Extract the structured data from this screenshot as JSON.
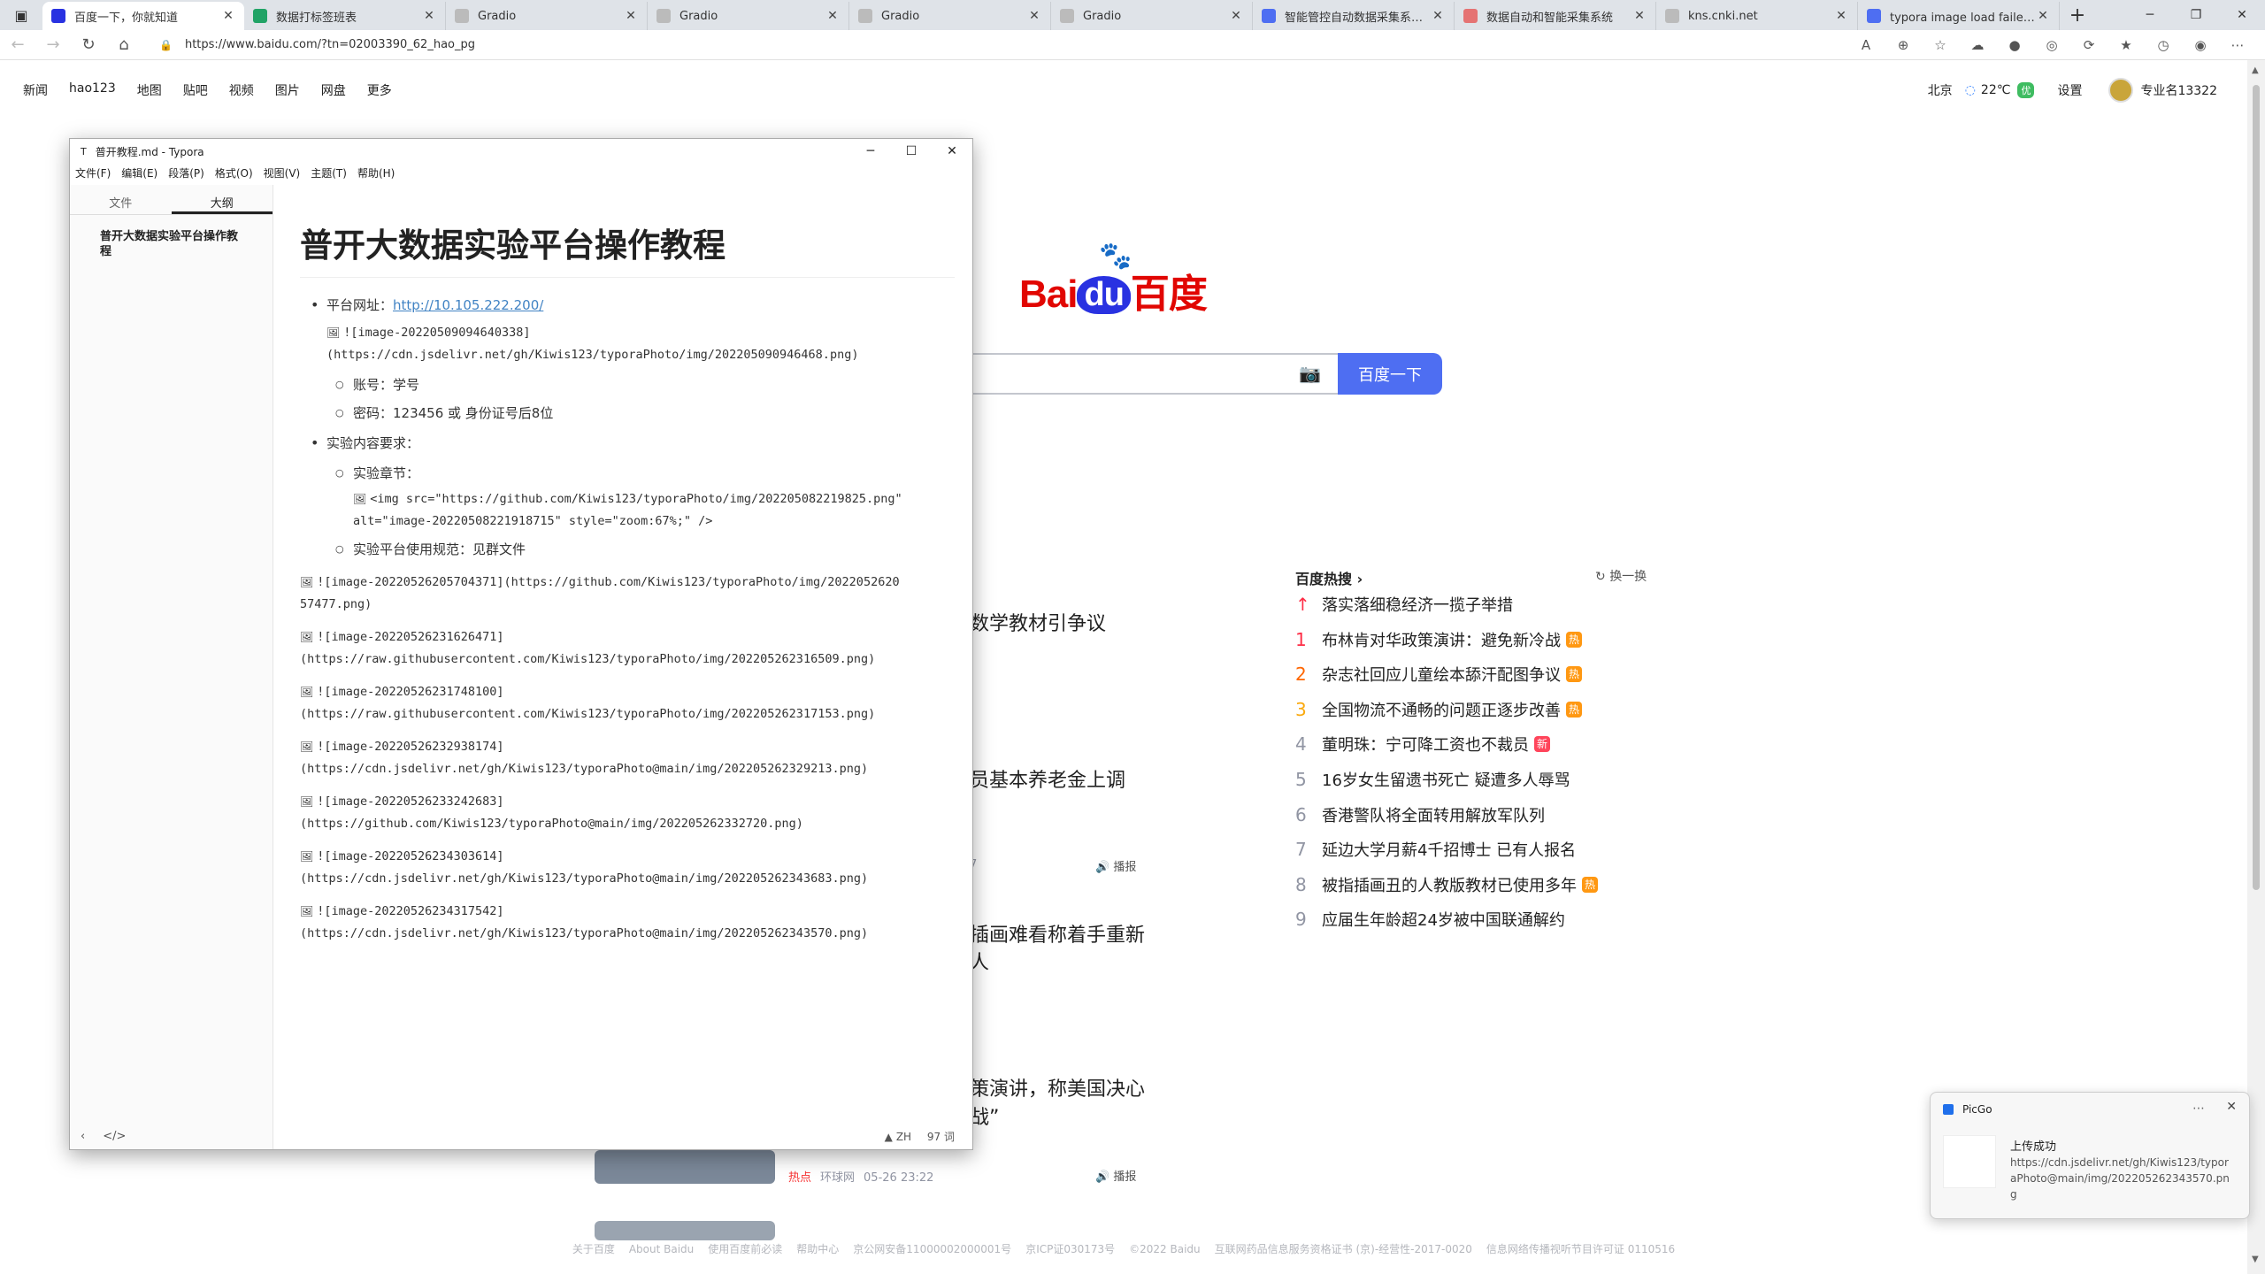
{
  "browser": {
    "tabs": [
      {
        "label": "百度一下，你就知道",
        "icon": "baidu-paw-icon",
        "color": "#2932e1",
        "active": true
      },
      {
        "label": "数据打标签班表",
        "icon": "sheet-icon",
        "color": "#21a366"
      },
      {
        "label": "Gradio",
        "icon": "page-icon",
        "color": "#bbb"
      },
      {
        "label": "Gradio",
        "icon": "page-icon",
        "color": "#bbb"
      },
      {
        "label": "Gradio",
        "icon": "page-icon",
        "color": "#bbb"
      },
      {
        "label": "Gradio",
        "icon": "page-icon",
        "color": "#bbb"
      },
      {
        "label": "智能管控自动数据采集系统和",
        "icon": "search-icon",
        "color": "#4e6ef2"
      },
      {
        "label": "数据自动和智能采集系统",
        "icon": "doc-icon",
        "color": "#e57373"
      },
      {
        "label": "kns.cnki.net",
        "icon": "page-icon",
        "color": "#bbb"
      },
      {
        "label": "typora image load failed - 搜索",
        "icon": "search-icon",
        "color": "#4e6ef2"
      }
    ],
    "url": "https://www.baidu.com/?tn=02003390_62_hao_pg"
  },
  "baidu": {
    "nav": [
      "新闻",
      "hao123",
      "地图",
      "贴吧",
      "视频",
      "图片",
      "网盘",
      "更多"
    ],
    "city": "北京",
    "temp": "22℃",
    "aqi": "优",
    "settings": "设置",
    "username": "专业名13322",
    "logo_text": {
      "bai": "Bai",
      "du": "du",
      "cn": "百度"
    },
    "search_button": "百度一下",
    "news": [
      {
        "title": "数学教材引争议"
      },
      {
        "title": "员基本养老金上调",
        "meta_time": "7",
        "report": "播报"
      },
      {
        "title_line1": "插画难看称着手重新",
        "title_line2": "人"
      },
      {
        "title_line1": "策演讲，称美国决心",
        "title_line2": "战”",
        "hot": "热点",
        "source": "环球网",
        "time": "05-26 23:22",
        "report": "播报"
      }
    ],
    "hot": {
      "title": "百度热搜",
      "refresh": "换一换",
      "items": [
        {
          "rank": "↑",
          "text": "落实落细稳经济一揽子举措",
          "badge": ""
        },
        {
          "rank": "1",
          "text": "布林肯对华政策演讲：避免新冷战",
          "badge": "热"
        },
        {
          "rank": "2",
          "text": "杂志社回应儿童绘本舔汗配图争议",
          "badge": "热"
        },
        {
          "rank": "3",
          "text": "全国物流不通畅的问题正逐步改善",
          "badge": "热"
        },
        {
          "rank": "4",
          "text": "董明珠：宁可降工资也不裁员",
          "badge": "新"
        },
        {
          "rank": "5",
          "text": "16岁女生留遗书死亡 疑遭多人辱骂",
          "badge": ""
        },
        {
          "rank": "6",
          "text": "香港警队将全面转用解放军队列",
          "badge": ""
        },
        {
          "rank": "7",
          "text": "延边大学月薪4千招博士 已有人报名",
          "badge": ""
        },
        {
          "rank": "8",
          "text": "被指插画丑的人教版教材已使用多年",
          "badge": "热"
        },
        {
          "rank": "9",
          "text": "应届生年龄超24岁被中国联通解约",
          "badge": ""
        }
      ]
    },
    "footer": [
      "关于百度",
      "About Baidu",
      "使用百度前必读",
      "帮助中心",
      "京公网安备11000002000001号",
      "京ICP证030173号",
      "©2022 Baidu",
      "互联网药品信息服务资格证书 (京)-经营性-2017-0020",
      "信息网络传播视听节目许可证 0110516"
    ]
  },
  "typora": {
    "title": "普开教程.md - Typora",
    "menu": [
      "文件(F)",
      "编辑(E)",
      "段落(P)",
      "格式(O)",
      "视图(V)",
      "主题(T)",
      "帮助(H)"
    ],
    "side_tabs": {
      "files": "文件",
      "outline": "大纲"
    },
    "outline_item": "普开大数据实验平台操作教程",
    "h1": "普开大数据实验平台操作教程",
    "platform_label": "平台网址：",
    "platform_url": "http://10.105.222.200/",
    "img1": "![image-20220509094640338](https://cdn.jsdelivr.net/gh/Kiwis123/typoraPhoto/img/202205090946468.png)",
    "account": "账号：学号",
    "password": "密码：123456 或 身份证号后8位",
    "req": "实验内容要求：",
    "chapter": "实验章节：",
    "img_html": "<img src=\"https://github.com/Kiwis123/typoraPhoto/img/202205082219825.png\" alt=\"image-20220508221918715\" style=\"zoom:67%;\" />",
    "norm": "实验平台使用规范：见群文件",
    "raw_images": [
      "![image-20220526205704371](https://github.com/Kiwis123/typoraPhoto/img/2022052620 57477.png)",
      "![image-20220526231626471](https://raw.githubusercontent.com/Kiwis123/typoraPhoto/img/202205262316509.png)",
      "![image-20220526231748100](https://raw.githubusercontent.com/Kiwis123/typoraPhoto/img/202205262317153.png)",
      "![image-20220526232938174](https://cdn.jsdelivr.net/gh/Kiwis123/typoraPhoto@main/img/202205262329213.png)",
      "![image-20220526233242683](https://github.com/Kiwis123/typoraPhoto@main/img/202205262332720.png)",
      "![image-20220526234303614](https://cdn.jsdelivr.net/gh/Kiwis123/typoraPhoto@main/img/202205262343683.png)",
      "![image-20220526234317542](https://cdn.jsdelivr.net/gh/Kiwis123/typoraPhoto@main/img/202205262343570.png)"
    ],
    "status_lang": "ZH",
    "status_words": "97 词"
  },
  "picgo": {
    "app": "PicGo",
    "title": "上传成功",
    "url": "https://cdn.jsdelivr.net/gh/Kiwis123/typoraPhoto@main/img/202205262343570.png"
  }
}
